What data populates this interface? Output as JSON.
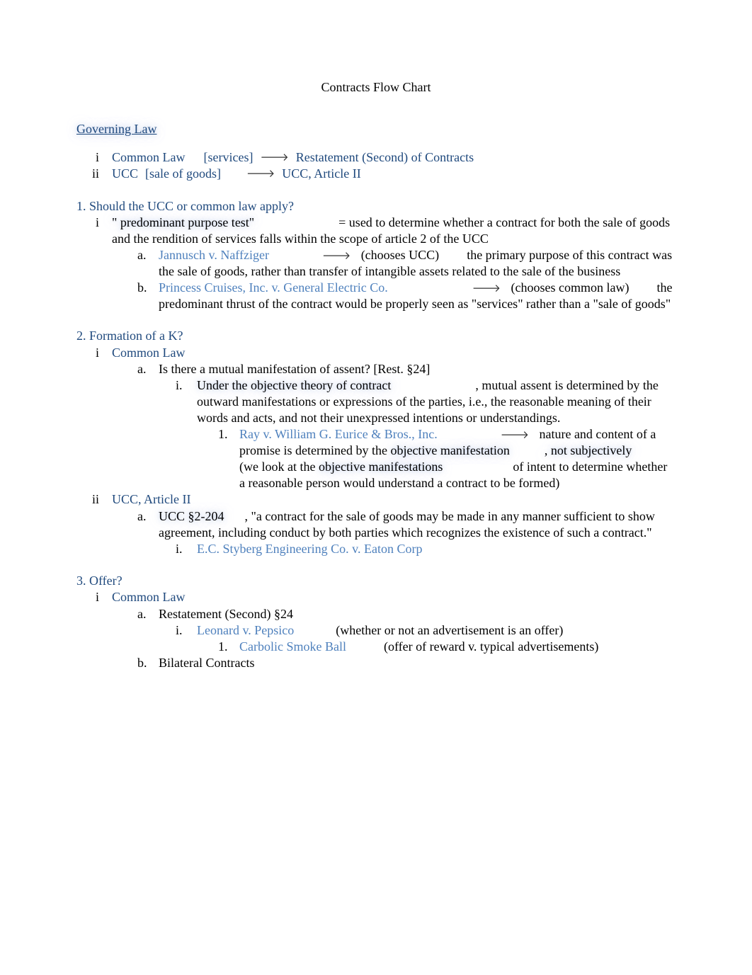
{
  "title": "Contracts Flow Chart",
  "governing": {
    "heading": "Governing Law",
    "items": [
      {
        "num": "i",
        "label": "Common Law",
        "bracket": "[services]",
        "target": "Restatement (Second) of Contracts"
      },
      {
        "num": "ii",
        "label": "UCC",
        "bracket": "[sale of goods]",
        "target": "UCC, Article II"
      }
    ]
  },
  "s1": {
    "heading": "1. Should the UCC or common law apply?",
    "i": {
      "num": "i",
      "term": "\" predominant purpose test\"",
      "desc": "= used to determine whether a contract for both the sale of goods and the rendition of services falls within the scope of article 2 of the UCC"
    },
    "a": {
      "letter": "a.",
      "case": "Jannusch v. Naffziger",
      "paren": "(chooses UCC)",
      "tail": "the primary purpose of this contract was the sale of goods, rather than transfer of intangible assets related to the sale of the business"
    },
    "b": {
      "letter": "b.",
      "case": "Princess Cruises, Inc. v. General Electric Co.",
      "paren": "(chooses common law)",
      "tail": "the predominant thrust of the contract would be properly seen as \"services\" rather than a \"sale of goods\""
    }
  },
  "s2": {
    "heading": "2. Formation of a K?",
    "i": {
      "num": "i",
      "label": "Common Law"
    },
    "a": {
      "letter": "a.",
      "q": "Is there a mutual manifestation of assent? [Rest. §24]"
    },
    "ai": {
      "num": "i.",
      "lead": "Under the objective theory of contract",
      "bridge": ",  mutual assent",
      "body": "is determined by the outward manifestations or expressions of the parties, i.e., the reasonable meaning of their words and acts, and not their unexpressed intentions or understandings."
    },
    "ai1": {
      "num": "1.",
      "case": "Ray v. William G. Eurice & Bros., Inc.",
      "lead1": "nature and content of a promise is determined by the",
      "obj1": "objective manifestation",
      "mid1": ", not subjectively",
      "mid_tail": "(we",
      "obj2_pre": "look at the ",
      "obj2": "objective manifestations",
      "tail": "of intent to determine whether a reasonable person would understand a contract to be formed)"
    },
    "ii": {
      "num": "ii",
      "label": "UCC, Article II"
    },
    "iia": {
      "letter": "a.",
      "code": "UCC §2-204",
      "bridge": ",  \"a contract for the sale of goods may be made in",
      "body": "any manner sufficient to show agreement, including conduct by both parties which recognizes the existence of such a contract.\""
    },
    "iiai": {
      "num": "i.",
      "case": "E.C. Styberg Engineering Co. v. Eaton Corp"
    }
  },
  "s3": {
    "heading": "3. Offer?",
    "i": {
      "num": "i",
      "label": "Common Law"
    },
    "a": {
      "letter": "a.",
      "text": "Restatement (Second) §24"
    },
    "ai": {
      "num": "i.",
      "case": "Leonard v. Pepsico",
      "paren": "(whether or not an advertisement is an offer)"
    },
    "ai1": {
      "num": "1.",
      "case": "Carbolic Smoke Ball",
      "paren": "(offer of reward v. typical advertisements)"
    },
    "b": {
      "letter": "b.",
      "text": "Bilateral Contracts"
    }
  }
}
